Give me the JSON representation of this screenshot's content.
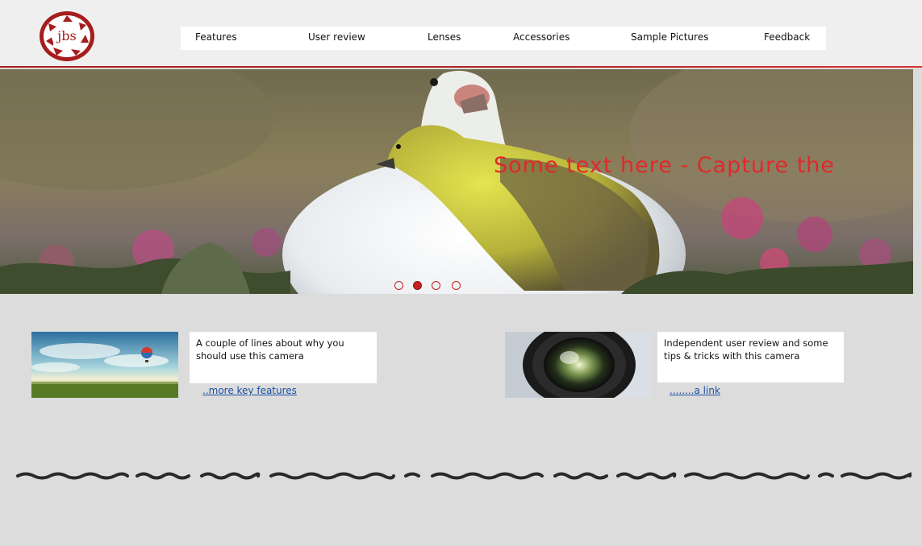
{
  "brand": {
    "logo_text": "jbs",
    "accent": "#a51d1d"
  },
  "nav": {
    "items": [
      {
        "label": "Features"
      },
      {
        "label": "User review"
      },
      {
        "label": "Lenses"
      },
      {
        "label": "Accessories"
      },
      {
        "label": "Sample Pictures"
      },
      {
        "label": "Feedback"
      }
    ]
  },
  "hero": {
    "caption": "Some text here - Capture the",
    "caption_color": "#e0292b",
    "slides": 4,
    "active_slide": 2
  },
  "cards": [
    {
      "text": "A couple of lines about why you should use this camera",
      "link": "..more key features",
      "image_icon": "balloon-landscape-image"
    },
    {
      "text": "Independent user review and some tips & tricks  with this camera",
      "link": "........a link",
      "image_icon": "camera-lens-image"
    }
  ]
}
